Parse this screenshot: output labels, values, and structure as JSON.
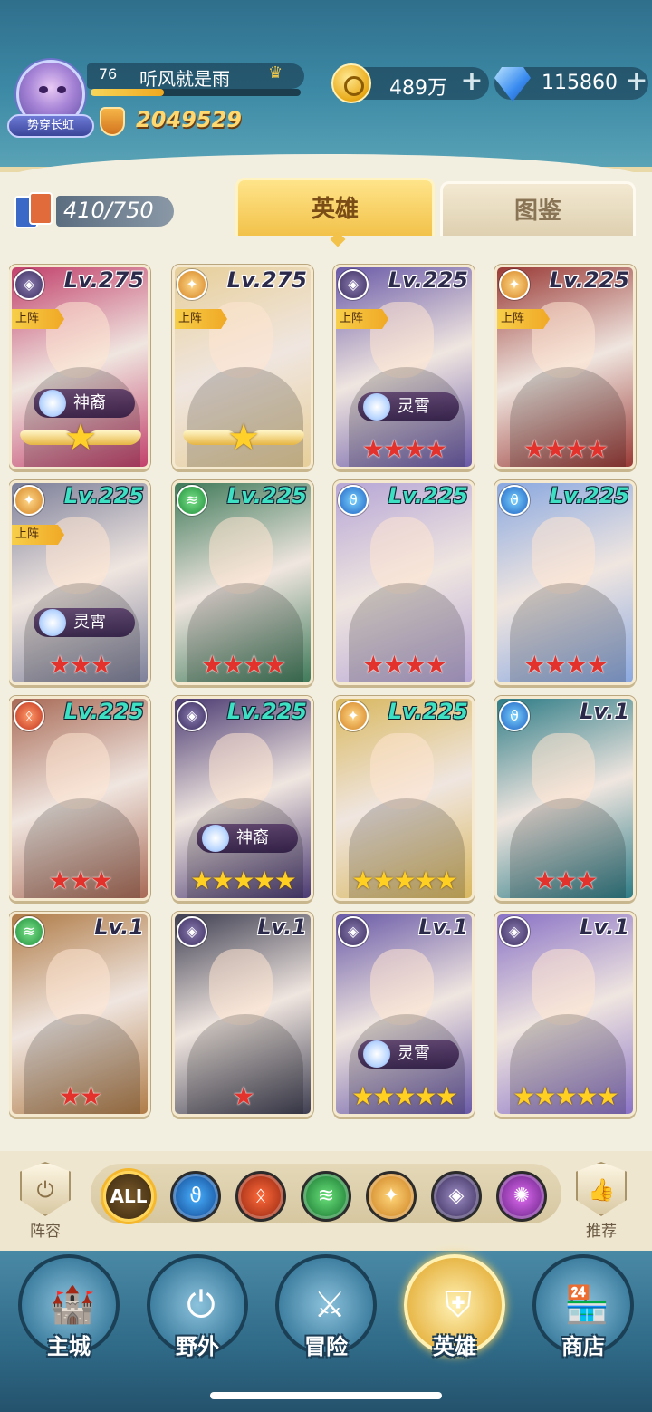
{
  "player": {
    "level": "76",
    "name": "听风就是雨",
    "avatar_title": "势穿长虹",
    "xp_fraction": 0.35,
    "power": "2049529"
  },
  "resources": {
    "gold": "489万",
    "gems": "115860"
  },
  "collection": {
    "count": "410/750"
  },
  "tabs": [
    {
      "label": "英雄",
      "active": true
    },
    {
      "label": "图鉴",
      "active": false
    }
  ],
  "heroes": [
    {
      "level": "Lv.275",
      "level_color": "purple",
      "faction": "purple",
      "deployed": "上阵",
      "tag": "神裔",
      "stars": "★",
      "star_style": "wings",
      "bg": "#c2416c"
    },
    {
      "level": "Lv.275",
      "level_color": "purple",
      "faction": "orange",
      "deployed": "上阵",
      "tag": "",
      "stars": "★",
      "star_style": "wings",
      "bg": "#e7cf9a"
    },
    {
      "level": "Lv.225",
      "level_color": "purple",
      "faction": "purple",
      "deployed": "上阵",
      "tag": "灵霄",
      "stars": "★★★★",
      "star_style": "red",
      "bg": "#6a5aa8"
    },
    {
      "level": "Lv.225",
      "level_color": "purple",
      "faction": "orange",
      "deployed": "上阵",
      "tag": "",
      "stars": "★★★★",
      "star_style": "red",
      "bg": "#9a3a36"
    },
    {
      "level": "Lv.225",
      "level_color": "green",
      "faction": "orange",
      "deployed": "上阵",
      "tag": "灵霄",
      "stars": "★★★",
      "star_style": "red",
      "bg": "#7c7f9a"
    },
    {
      "level": "Lv.225",
      "level_color": "green",
      "faction": "green",
      "deployed": "",
      "tag": "",
      "stars": "★★★★",
      "star_style": "red",
      "bg": "#3f7a5a"
    },
    {
      "level": "Lv.225",
      "level_color": "green",
      "faction": "blue",
      "deployed": "",
      "tag": "",
      "stars": "★★★★",
      "star_style": "red",
      "bg": "#b6a6d6"
    },
    {
      "level": "Lv.225",
      "level_color": "green",
      "faction": "blue",
      "deployed": "",
      "tag": "",
      "stars": "★★★★",
      "star_style": "red",
      "bg": "#8aa8e0"
    },
    {
      "level": "Lv.225",
      "level_color": "green",
      "faction": "red",
      "deployed": "",
      "tag": "",
      "stars": "★★★",
      "star_style": "red",
      "bg": "#a86a56"
    },
    {
      "level": "Lv.225",
      "level_color": "green",
      "faction": "purple",
      "deployed": "",
      "tag": "神裔",
      "stars": "★★★★★",
      "star_style": "gold",
      "bg": "#4a3a72"
    },
    {
      "level": "Lv.225",
      "level_color": "green",
      "faction": "orange",
      "deployed": "",
      "tag": "",
      "stars": "★★★★★",
      "star_style": "gold",
      "bg": "#d9b860"
    },
    {
      "level": "Lv.1",
      "level_color": "purple",
      "faction": "blue",
      "deployed": "",
      "tag": "",
      "stars": "★★★",
      "star_style": "red",
      "bg": "#2e7c86"
    },
    {
      "level": "Lv.1",
      "level_color": "purple",
      "faction": "green",
      "deployed": "",
      "tag": "",
      "stars": "★★",
      "star_style": "red",
      "bg": "#b07c48"
    },
    {
      "level": "Lv.1",
      "level_color": "purple",
      "faction": "purple",
      "deployed": "",
      "tag": "",
      "stars": "★",
      "star_style": "red",
      "bg": "#3f3f52"
    },
    {
      "level": "Lv.1",
      "level_color": "purple",
      "faction": "purple",
      "deployed": "",
      "tag": "灵霄",
      "stars": "★★★★★",
      "star_style": "gold",
      "bg": "#6a5aa8"
    },
    {
      "level": "Lv.1",
      "level_color": "purple",
      "faction": "purple",
      "deployed": "",
      "tag": "",
      "stars": "★★★★★",
      "star_style": "gold",
      "bg": "#8a72c6"
    }
  ],
  "filters": {
    "all_label": "ALL",
    "lineup_label": "阵容",
    "recommend_label": "推荐"
  },
  "nav": [
    {
      "label": "主城",
      "glyph": "🏰",
      "active": false
    },
    {
      "label": "野外",
      "glyph": "⏻",
      "active": false
    },
    {
      "label": "冒险",
      "glyph": "⚔",
      "active": false
    },
    {
      "label": "英雄",
      "glyph": "⛨",
      "active": true
    },
    {
      "label": "商店",
      "glyph": "🏪",
      "active": false
    }
  ]
}
